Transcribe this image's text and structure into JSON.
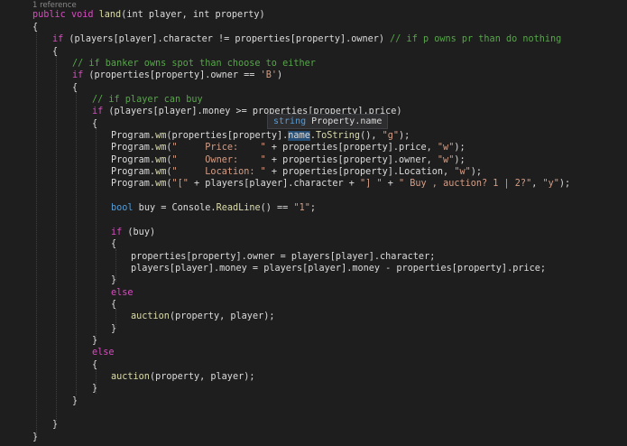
{
  "codelens": "1 reference",
  "tooltip": {
    "type": "string",
    "member": "Property.name"
  },
  "code": {
    "l1_public": "public",
    "l1_void": "void",
    "l1_name": "land",
    "l1_p1": "(int player, int property)",
    "brace_open": "{",
    "brace_close": "}",
    "l3_if": "if",
    "l3_cond": " (players[player].character != properties[property].owner) ",
    "l3_cmt": "// if p owns pr than do nothing",
    "l5_cmt": "// if banker owns spot than choose to either",
    "l6_if": "if",
    "l6_cond": " (properties[property].owner == ",
    "l6_str": "'B'",
    "l6_end": ")",
    "l8_cmt": "// if player can buy",
    "l9_if": "if",
    "l9_cond": " (players[player].money >= properties[property].price)",
    "l11_a": "Program.",
    "l11_wm": "wm",
    "l11_b": "(properties[property].",
    "l11_sel": "name",
    "l11_c": ".",
    "l11_ts": "ToString",
    "l11_d": "(), ",
    "l11_str": "\"g\"",
    "l11_e": ");",
    "l12_a": "Program.",
    "l12_wm": "wm",
    "l12_b": "(",
    "l12_str1": "\"     Price:    \"",
    "l12_c": " + properties[property].price, ",
    "l12_str2": "\"w\"",
    "l12_d": ");",
    "l13_a": "Program.",
    "l13_wm": "wm",
    "l13_b": "(",
    "l13_str1": "\"     Owner:    \"",
    "l13_c": " + properties[property].owner, ",
    "l13_str2": "\"w\"",
    "l13_d": ");",
    "l14_a": "Program.",
    "l14_wm": "wm",
    "l14_b": "(",
    "l14_str1": "\"     Location: \"",
    "l14_c": " + properties[property].Location, ",
    "l14_str2": "\"w\"",
    "l14_d": ");",
    "l15_a": "Program.",
    "l15_wm": "wm",
    "l15_b": "(",
    "l15_str1": "\"[\"",
    "l15_c": " + players[player].character + ",
    "l15_str2": "\"] \"",
    "l15_d": " + ",
    "l15_str3": "\" Buy , auction? 1 | 2?\"",
    "l15_e": ", ",
    "l15_str4": "\"y\"",
    "l15_f": ");",
    "l17_bool": "bool",
    "l17_a": " buy = Console.",
    "l17_rl": "ReadLine",
    "l17_b": "() == ",
    "l17_str": "\"1\"",
    "l17_c": ";",
    "l19_if": "if",
    "l19_a": " (buy)",
    "l21": "properties[property].owner = players[player].character;",
    "l22": "players[player].money = players[player].money - properties[property].price;",
    "else": "else",
    "l26_fn": "auction",
    "l26_a": "(property, player);"
  }
}
